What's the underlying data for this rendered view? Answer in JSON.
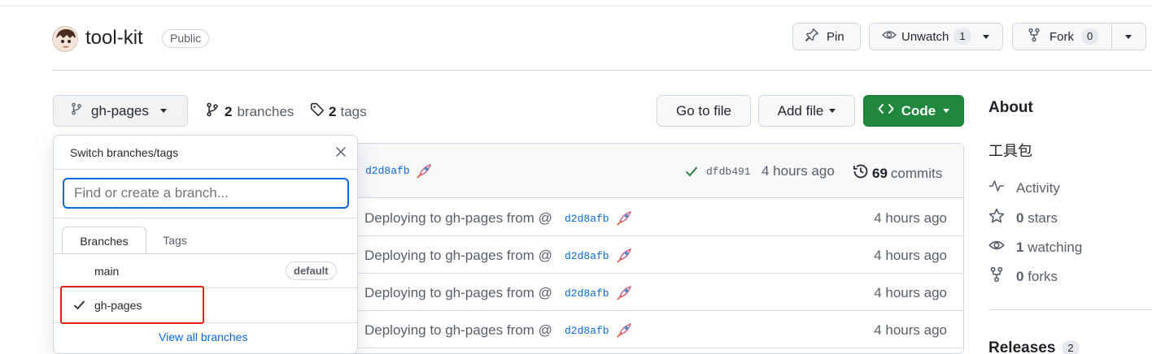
{
  "repo": {
    "name": "tool-kit",
    "visibility": "Public",
    "pin_label": "Pin",
    "unwatch_label": "Unwatch",
    "watch_count": "1",
    "fork_label": "Fork",
    "fork_count": "0"
  },
  "branch_bar": {
    "current_branch": "gh-pages",
    "branches_count": "2",
    "branches_label": "branches",
    "tags_count": "2",
    "tags_label": "tags",
    "go_to_file": "Go to file",
    "add_file": "Add file",
    "code": "Code"
  },
  "commit_header": {
    "hash_partial": "d2d8afb",
    "latest_hash": "dfdb491",
    "latest_time": "4 hours ago",
    "commits_count": "69",
    "commits_label": "commits"
  },
  "file_rows": [
    {
      "message": "Deploying to gh-pages from @",
      "hash": "d2d8afb",
      "time": "4 hours ago"
    },
    {
      "message": "Deploying to gh-pages from @",
      "hash": "d2d8afb",
      "time": "4 hours ago"
    },
    {
      "message": "Deploying to gh-pages from @",
      "hash": "d2d8afb",
      "time": "4 hours ago"
    },
    {
      "message": "Deploying to gh-pages from @",
      "hash": "d2d8afb",
      "time": "4 hours ago"
    }
  ],
  "dropdown": {
    "title": "Switch branches/tags",
    "search_placeholder": "Find or create a branch...",
    "tabs": [
      "Branches",
      "Tags"
    ],
    "branches": [
      {
        "name": "main",
        "badge": "default"
      },
      {
        "name": "gh-pages",
        "selected": true
      }
    ],
    "view_all": "View all branches"
  },
  "about": {
    "heading": "About",
    "description": "工具包",
    "activity": "Activity",
    "stars_count": "0",
    "stars_label": "stars",
    "watching_count": "1",
    "watching_label": "watching",
    "forks_count": "0",
    "forks_label": "forks",
    "releases_label": "Releases",
    "releases_count": "2"
  },
  "colors": {
    "code_button": "#1f883d",
    "link": "#0969da",
    "highlight_box": "#e0231c"
  }
}
